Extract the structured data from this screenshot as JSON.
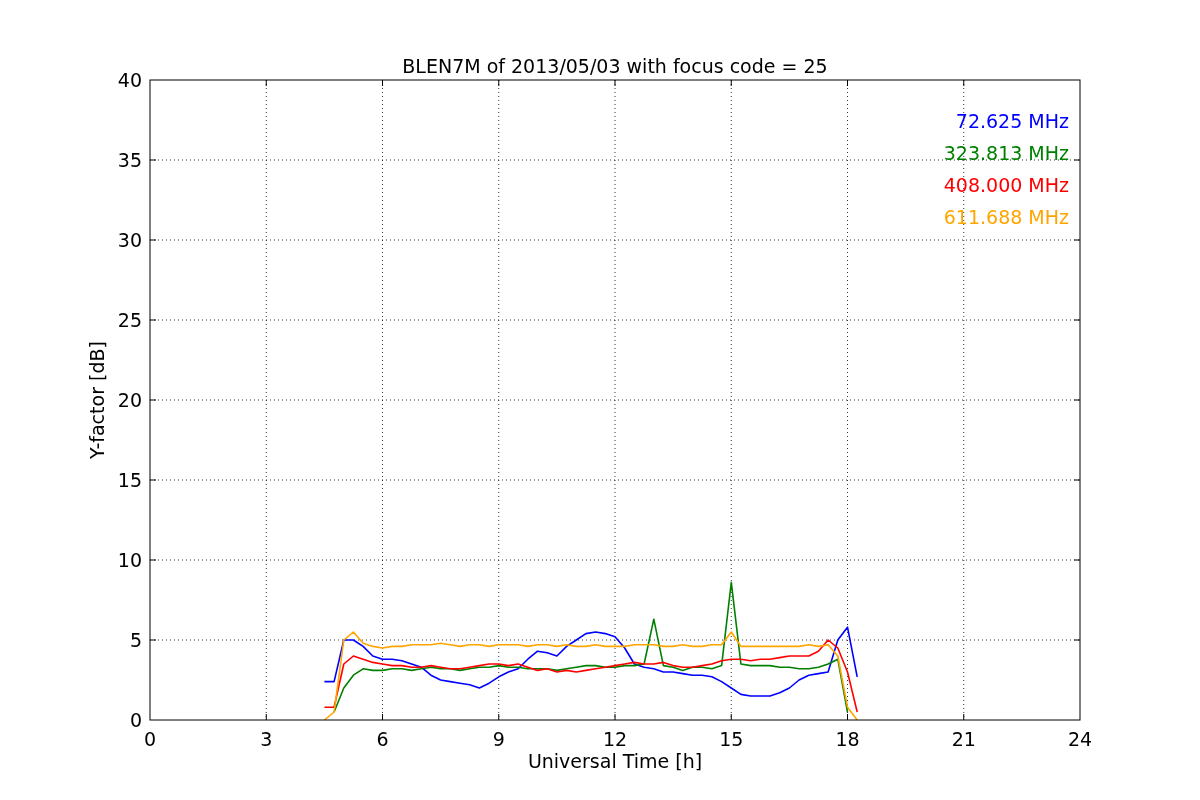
{
  "chart_data": {
    "type": "line",
    "title": "BLEN7M of 2013/05/03 with focus code = 25",
    "xlabel": "Universal Time [h]",
    "ylabel": "Y-factor [dB]",
    "x": [
      4.5,
      4.75,
      5,
      5.25,
      5.5,
      5.75,
      6,
      6.25,
      6.5,
      6.75,
      7,
      7.25,
      7.5,
      7.75,
      8,
      8.25,
      8.5,
      8.75,
      9,
      9.25,
      9.5,
      9.75,
      10,
      10.25,
      10.5,
      10.75,
      11,
      11.25,
      11.5,
      11.75,
      12,
      12.25,
      12.5,
      12.75,
      13,
      13.25,
      13.5,
      13.75,
      14,
      14.25,
      14.5,
      14.75,
      15,
      15.25,
      15.5,
      15.75,
      16,
      16.25,
      16.5,
      16.75,
      17,
      17.25,
      17.5,
      17.75,
      18,
      18.25
    ],
    "series": [
      {
        "name": "72.625 MHz",
        "color": "#0000ff",
        "values": [
          2.4,
          2.4,
          5.0,
          5.0,
          4.6,
          4.0,
          3.8,
          3.8,
          3.7,
          3.5,
          3.3,
          2.8,
          2.5,
          2.4,
          2.3,
          2.2,
          2.0,
          2.3,
          2.7,
          3.0,
          3.2,
          3.8,
          4.3,
          4.2,
          4.0,
          4.6,
          5.0,
          5.4,
          5.5,
          5.4,
          5.2,
          4.5,
          3.5,
          3.3,
          3.2,
          3.0,
          3.0,
          2.9,
          2.8,
          2.8,
          2.7,
          2.4,
          2.0,
          1.6,
          1.5,
          1.5,
          1.5,
          1.7,
          2.0,
          2.5,
          2.8,
          2.9,
          3.0,
          5.0,
          5.8,
          2.7
        ]
      },
      {
        "name": "323.813 MHz",
        "color": "#008000",
        "values": [
          null,
          0.5,
          2.0,
          2.8,
          3.2,
          3.1,
          3.1,
          3.2,
          3.2,
          3.1,
          3.2,
          3.3,
          3.2,
          3.2,
          3.1,
          3.2,
          3.3,
          3.3,
          3.4,
          3.3,
          3.3,
          3.2,
          3.2,
          3.2,
          3.1,
          3.2,
          3.3,
          3.4,
          3.4,
          3.3,
          3.3,
          3.4,
          3.4,
          3.5,
          6.3,
          3.4,
          3.3,
          3.1,
          3.3,
          3.3,
          3.2,
          3.4,
          8.6,
          3.5,
          3.4,
          3.4,
          3.4,
          3.3,
          3.3,
          3.2,
          3.2,
          3.3,
          3.5,
          3.8,
          0.5,
          null
        ]
      },
      {
        "name": "408.000 MHz",
        "color": "#ff0000",
        "values": [
          0.8,
          0.8,
          3.5,
          4.0,
          3.8,
          3.6,
          3.5,
          3.4,
          3.4,
          3.3,
          3.3,
          3.4,
          3.3,
          3.2,
          3.2,
          3.3,
          3.4,
          3.5,
          3.5,
          3.4,
          3.5,
          3.3,
          3.1,
          3.2,
          3.0,
          3.1,
          3.0,
          3.1,
          3.2,
          3.3,
          3.4,
          3.5,
          3.6,
          3.5,
          3.5,
          3.6,
          3.4,
          3.3,
          3.3,
          3.4,
          3.5,
          3.7,
          3.8,
          3.8,
          3.7,
          3.8,
          3.8,
          3.9,
          4.0,
          4.0,
          4.0,
          4.3,
          5.0,
          4.5,
          3.0,
          0.5
        ]
      },
      {
        "name": "611.688 MHz",
        "color": "#ffa500",
        "values": [
          0.0,
          0.5,
          5.0,
          5.5,
          4.8,
          4.6,
          4.5,
          4.6,
          4.6,
          4.7,
          4.7,
          4.7,
          4.8,
          4.7,
          4.6,
          4.7,
          4.7,
          4.6,
          4.7,
          4.7,
          4.7,
          4.6,
          4.7,
          4.7,
          4.6,
          4.7,
          4.6,
          4.6,
          4.7,
          4.6,
          4.6,
          4.6,
          4.7,
          4.7,
          4.7,
          4.6,
          4.6,
          4.7,
          4.6,
          4.6,
          4.7,
          4.7,
          5.5,
          4.6,
          4.6,
          4.6,
          4.6,
          4.6,
          4.6,
          4.6,
          4.7,
          4.6,
          4.7,
          4.0,
          0.8,
          0.0
        ]
      }
    ],
    "xlim": [
      0,
      24
    ],
    "ylim": [
      0,
      40
    ],
    "xticks": [
      0,
      3,
      6,
      9,
      12,
      15,
      18,
      21,
      24
    ],
    "yticks": [
      0,
      5,
      10,
      15,
      20,
      25,
      30,
      35,
      40
    ],
    "grid": true
  }
}
